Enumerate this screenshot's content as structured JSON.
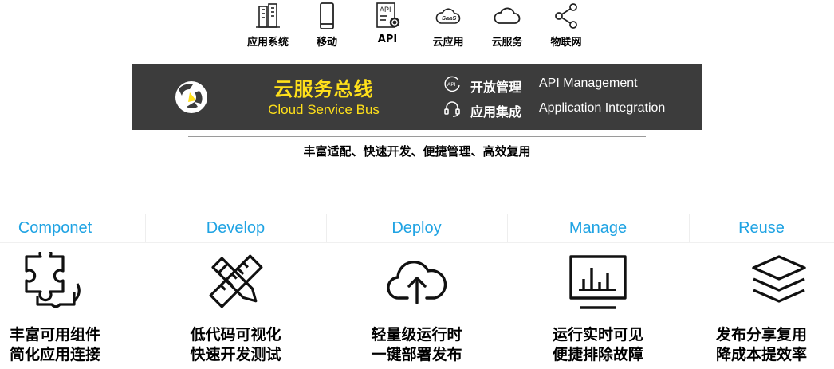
{
  "sources": [
    {
      "label": "应用系统",
      "icon": "building-icon"
    },
    {
      "label": "移动",
      "icon": "mobile-icon"
    },
    {
      "label": "API",
      "icon": "api-gear-icon"
    },
    {
      "label": "云应用",
      "icon": "saas-cloud-icon"
    },
    {
      "label": "云服务",
      "icon": "cloud-icon"
    },
    {
      "label": "物联网",
      "icon": "share-nodes-icon"
    }
  ],
  "bus": {
    "title_zh": "云服务总线",
    "title_en": "Cloud Service Bus",
    "title_color": "#ffe01a",
    "background": "#3c3c3c",
    "features": [
      {
        "zh": "开放管理",
        "en": "API Management",
        "icon": "api-circle-icon"
      },
      {
        "zh": "应用集成",
        "en": "Application Integration",
        "icon": "headset-icon"
      }
    ]
  },
  "tagline": "丰富适配、快速开发、便捷管理、高效复用",
  "stages": [
    {
      "name": "Componet",
      "icon": "puzzle-icon",
      "desc1": "丰富可用组件",
      "desc2": "简化应用连接"
    },
    {
      "name": "Develop",
      "icon": "ruler-pencil-icon",
      "desc1": "低代码可视化",
      "desc2": "快速开发测试"
    },
    {
      "name": "Deploy",
      "icon": "cloud-upload-icon",
      "desc1": "轻量级运行时",
      "desc2": "一键部署发布"
    },
    {
      "name": "Manage",
      "icon": "monitor-chart-icon",
      "desc1": "运行实时可见",
      "desc2": "便捷排除故障"
    },
    {
      "name": "Reuse",
      "icon": "layers-icon",
      "desc1": "发布分享复用",
      "desc2": "降成本提效率"
    }
  ],
  "accent": "#1fa3e3"
}
